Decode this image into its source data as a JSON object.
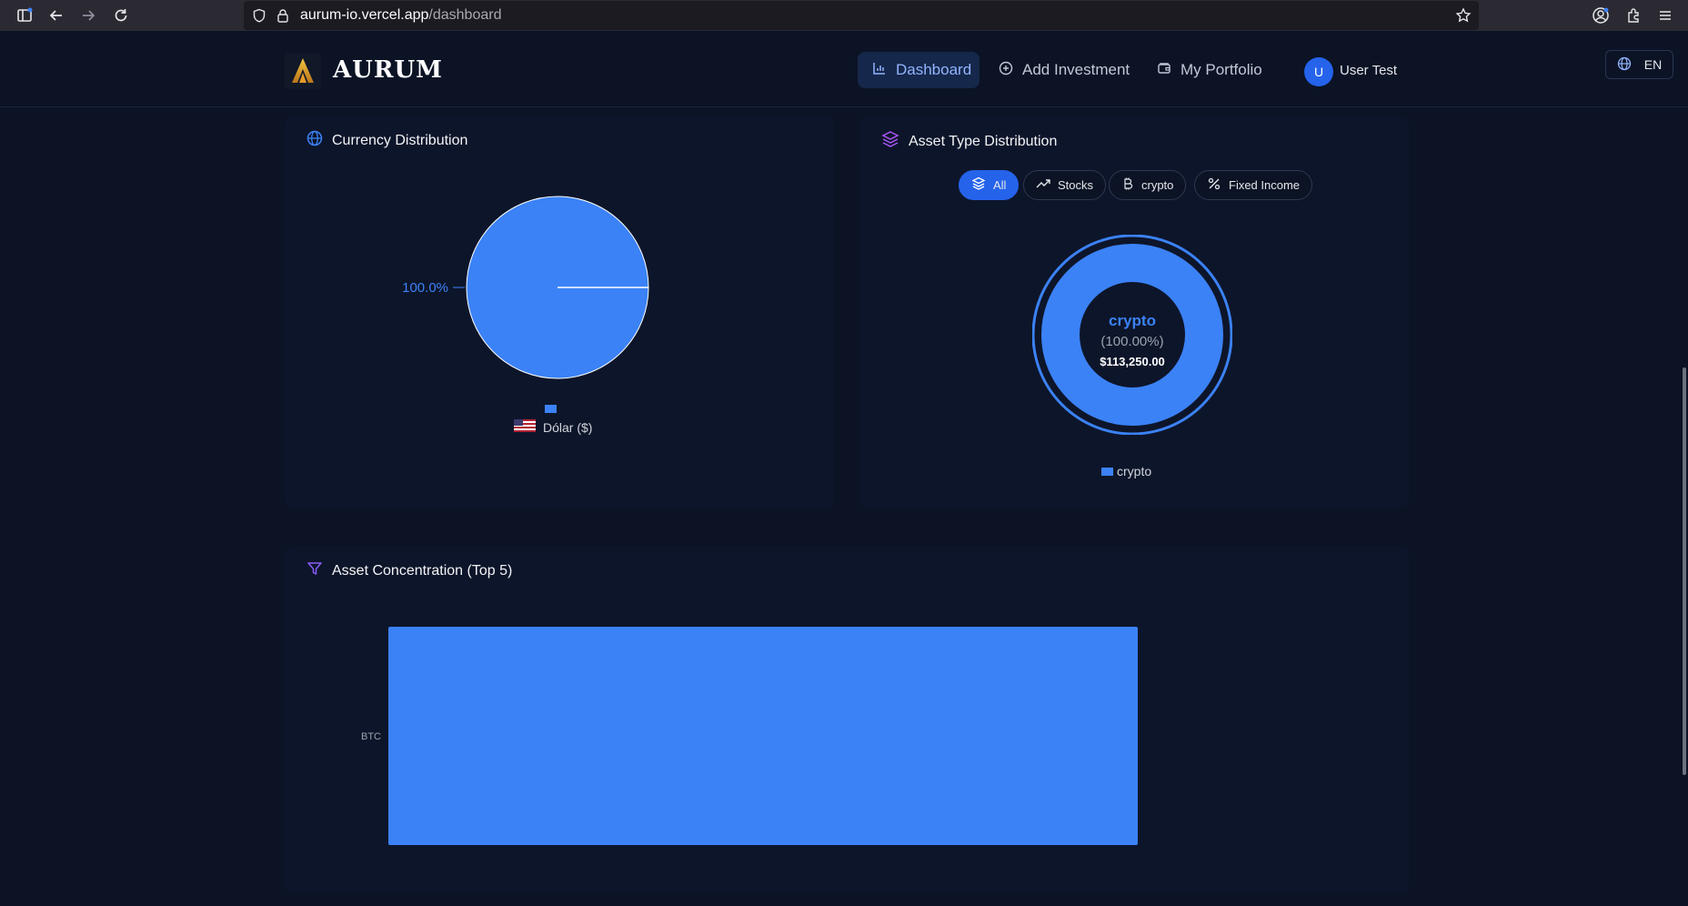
{
  "browser": {
    "url_host": "aurum-io.vercel.app",
    "url_path": "/dashboard"
  },
  "header": {
    "brand": "AURUM",
    "nav": [
      {
        "label": "Dashboard",
        "icon": "bar-chart-icon",
        "active": true
      },
      {
        "label": "Add Investment",
        "icon": "plus-circle-icon",
        "active": false
      },
      {
        "label": "My Portfolio",
        "icon": "wallet-icon",
        "active": false
      }
    ],
    "user": {
      "initial": "U",
      "name": "User Test"
    },
    "language": "EN"
  },
  "currency_card": {
    "title": "Currency Distribution",
    "icon": "globe-icon",
    "slice_label": "100.0%",
    "legend": "Dólar ($)"
  },
  "asset_type_card": {
    "title": "Asset Type Distribution",
    "icon": "layers-icon",
    "filters": [
      {
        "label": "All",
        "icon": "layers-icon",
        "active": true
      },
      {
        "label": "Stocks",
        "icon": "trending-up-icon",
        "active": false
      },
      {
        "label": "crypto",
        "icon": "bitcoin-icon",
        "active": false
      },
      {
        "label": "Fixed Income",
        "icon": "percent-icon",
        "active": false
      }
    ],
    "center": {
      "name": "crypto",
      "percent": "(100.00%)",
      "amount": "$113,250.00"
    },
    "legend": "crypto"
  },
  "concentration_card": {
    "title": "Asset Concentration (Top 5)",
    "icon": "funnel-icon"
  },
  "colors": {
    "accent": "#3b82f6",
    "background": "#0b1325",
    "card": "#0d152a"
  },
  "chart_data": [
    {
      "type": "pie",
      "title": "Currency Distribution",
      "categories": [
        "Dólar ($)"
      ],
      "values": [
        100.0
      ],
      "labels": [
        "100.0%"
      ],
      "legend": "bottom"
    },
    {
      "type": "pie",
      "title": "Asset Type Distribution",
      "categories": [
        "crypto"
      ],
      "values": [
        113250.0
      ],
      "percents": [
        100.0
      ],
      "legend": "bottom"
    },
    {
      "type": "bar",
      "title": "Asset Concentration (Top 5)",
      "orientation": "horizontal",
      "categories": [
        "BTC"
      ],
      "values": [
        100
      ],
      "xlim": [
        0,
        100
      ]
    }
  ]
}
